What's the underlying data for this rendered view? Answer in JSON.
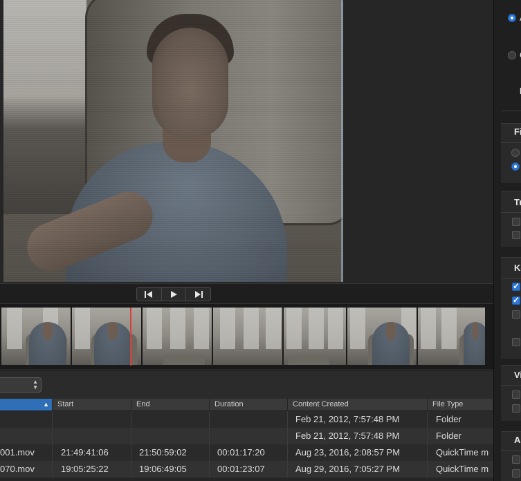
{
  "transport": {
    "prev_icon": "⎮◀",
    "play_icon": "▶",
    "next_icon": "▶⎮"
  },
  "file_list": {
    "columns": [
      "",
      "Start",
      "End",
      "Duration",
      "Content Created",
      "File Type"
    ],
    "rows": [
      {
        "name": "",
        "start": "",
        "end": "",
        "duration": "",
        "created": "Feb 21, 2012, 7:57:48 PM",
        "type": "Folder"
      },
      {
        "name": "",
        "start": "",
        "end": "",
        "duration": "",
        "created": "Feb 21, 2012, 7:57:48 PM",
        "type": "Folder"
      },
      {
        "name": "001.mov",
        "start": "21:49:41:06",
        "end": "21:50:59:02",
        "duration": "00:01:17:20",
        "created": "Aug 23, 2016, 2:08:57 PM",
        "type": "QuickTime m"
      },
      {
        "name": "070.mov",
        "start": "19:05:25:22",
        "end": "19:06:49:05",
        "duration": "00:01:23:07",
        "created": "Aug 29, 2016, 7:05:27 PM",
        "type": "QuickTime m"
      }
    ]
  },
  "inspector": {
    "radio_a_label": "A",
    "radio_c_label": "C",
    "e_label": "E",
    "sections": [
      "File",
      "Tra",
      "Key",
      "Vid",
      "Aud"
    ],
    "checkbox_states": {
      "key_1": true,
      "key_2": true,
      "key_3": false,
      "key_4": false
    }
  },
  "colors": {
    "accent": "#2f78d6",
    "playhead": "#d8403a",
    "header_sorted": "#2f6fb7"
  }
}
